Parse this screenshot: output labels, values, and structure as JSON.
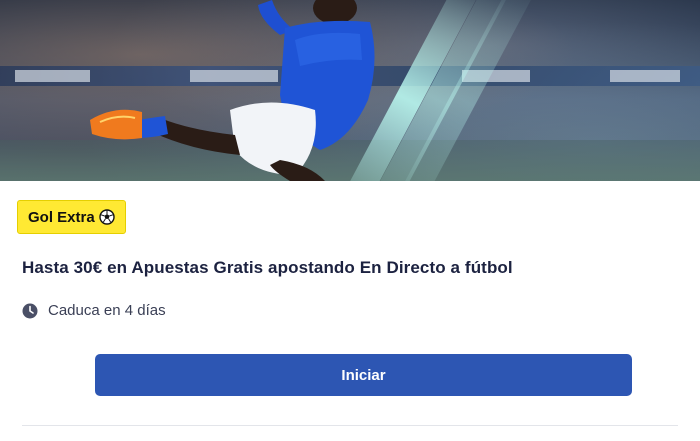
{
  "promo": {
    "badge": {
      "label": "Gol Extra",
      "icon": "soccer-ball-icon",
      "bg_color": "#ffe933"
    },
    "headline": "Hasta 30€ en Apuestas Gratis apostando En Directo a fútbol",
    "expiry": {
      "icon": "clock-icon",
      "text": "Caduca en 4 días"
    },
    "cta_label": "Iniciar",
    "colors": {
      "cta": "#2d56b3",
      "headline": "#1c2240"
    }
  }
}
